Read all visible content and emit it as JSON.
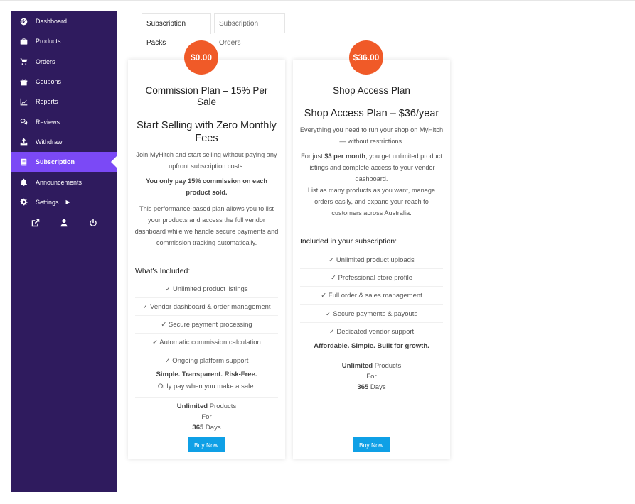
{
  "sidebar": {
    "items": [
      {
        "label": "Dashboard",
        "icon": "dashboard-icon"
      },
      {
        "label": "Products",
        "icon": "briefcase-icon"
      },
      {
        "label": "Orders",
        "icon": "cart-icon"
      },
      {
        "label": "Coupons",
        "icon": "gift-icon"
      },
      {
        "label": "Reports",
        "icon": "chart-line-icon"
      },
      {
        "label": "Reviews",
        "icon": "comments-icon"
      },
      {
        "label": "Withdraw",
        "icon": "upload-icon"
      },
      {
        "label": "Subscription",
        "icon": "book-icon"
      },
      {
        "label": "Announcements",
        "icon": "bell-icon"
      },
      {
        "label": "Settings",
        "icon": "gear-icon"
      }
    ],
    "active_index": 7,
    "bottom_icons": [
      "external-link-icon",
      "user-icon",
      "power-icon"
    ],
    "bg_color": "#2f1b5e",
    "active_color": "#7b49f6"
  },
  "tabs": [
    {
      "label": "Subscription Packs",
      "active": true
    },
    {
      "label": "Subscription Orders",
      "active": false
    }
  ],
  "cards": [
    {
      "price": "$0.00",
      "title": "Commission Plan – 15% Per Sale",
      "subtitle": "Start Selling with Zero Monthly Fees",
      "para1": "Join MyHitch and start selling without paying any upfront subscription costs.",
      "para2_bold": "You only pay 15% commission on each product sold.",
      "para3": "This performance-based plan allows you to list your products and access the full vendor dashboard while we handle secure payments and commission tracking automatically.",
      "included_heading": "What's Included:",
      "features": [
        "✓ Unlimited product listings",
        "✓ Vendor dashboard & order management",
        "✓ Secure payment processing",
        "✓ Automatic commission calculation",
        "✓ Ongoing platform support"
      ],
      "tagline_bold": "Simple. Transparent. Risk-Free.",
      "tagline": "Only pay when you make a sale.",
      "limit_products_bold": "Unlimited",
      "limit_products": " Products",
      "limit_for": "For",
      "limit_days_bold": "365",
      "limit_days": " Days",
      "button": "Buy Now"
    },
    {
      "price": "$36.00",
      "title": "Shop Access Plan",
      "subtitle": "Shop Access Plan – $36/year",
      "para1": "Everything you need to run your shop on MyHitch — without restrictions.",
      "para2_prefix": "For just ",
      "para2_bold": "$3 per month",
      "para2_suffix": ", you get unlimited product listings and complete access to your vendor dashboard.",
      "para3": "List as many products as you want, manage orders easily, and expand your reach to customers across Australia.",
      "included_heading": "Included in your subscription:",
      "features": [
        "✓ Unlimited product uploads",
        "✓ Professional store profile",
        "✓ Full order & sales management",
        "✓ Secure payments & payouts",
        "✓ Dedicated vendor support"
      ],
      "tagline_bold": "Affordable. Simple. Built for growth.",
      "limit_products_bold": "Unlimited",
      "limit_products": " Products",
      "limit_for": "For",
      "limit_days_bold": "365",
      "limit_days": " Days",
      "button": "Buy Now"
    }
  ],
  "colors": {
    "price_badge": "#f05a28",
    "buy_button": "#0fa0e6"
  }
}
